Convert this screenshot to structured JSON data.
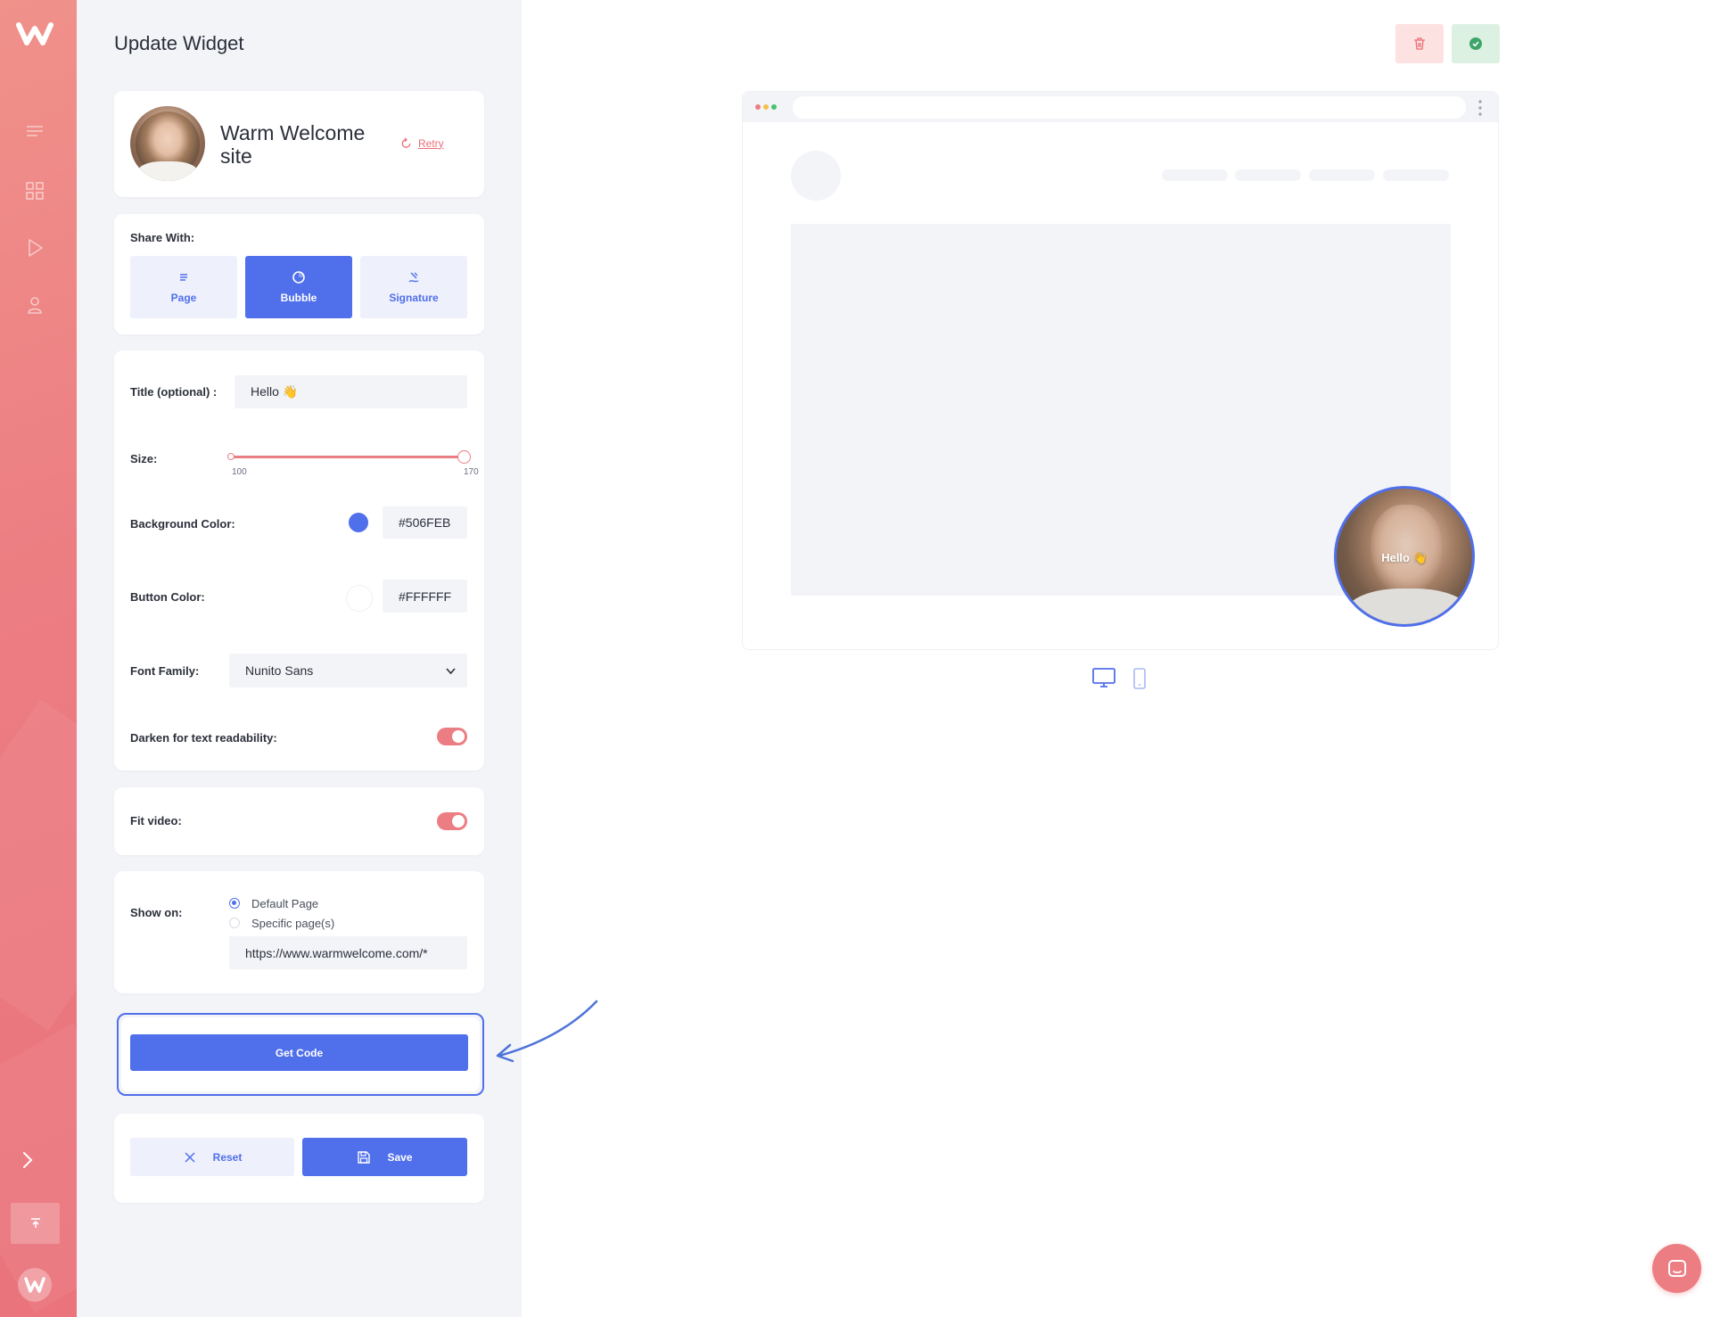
{
  "page": {
    "title": "Update Widget"
  },
  "video": {
    "name": "Warm Welcome site",
    "retry_label": "Retry"
  },
  "share": {
    "label": "Share With:",
    "options": [
      {
        "label": "Page",
        "icon": "page-lines-icon",
        "active": false
      },
      {
        "label": "Bubble",
        "icon": "bubble-circle-icon",
        "active": true
      },
      {
        "label": "Signature",
        "icon": "signature-pen-icon",
        "active": false
      }
    ]
  },
  "form": {
    "title_label": "Title (optional) :",
    "title_value": "Hello 👋",
    "size_label": "Size:",
    "size_min": "100",
    "size_max": "170",
    "size_value": 170,
    "bg_color_label": "Background Color:",
    "bg_color_value": "#506FEB",
    "button_color_label": "Button Color:",
    "button_color_value": "#FFFFFF",
    "font_label": "Font Family:",
    "font_value": "Nunito Sans",
    "darken_label": "Darken for text readability:",
    "darken_on": true
  },
  "fit": {
    "label": "Fit video:",
    "on": true
  },
  "show_on": {
    "label": "Show on:",
    "options": [
      {
        "label": "Default Page",
        "checked": true
      },
      {
        "label": "Specific page(s)",
        "checked": false
      }
    ],
    "url_value": "https://www.warmwelcome.com/*"
  },
  "actions": {
    "get_code": "Get Code",
    "reset": "Reset",
    "save": "Save"
  },
  "preview": {
    "bubble_title": "Hello 👋"
  },
  "colors": {
    "accent": "#506FEB",
    "brand_coral": "#EC7D82",
    "delete_bg": "#FDE2E2",
    "confirm_bg": "#DDF1E3"
  },
  "icons": {
    "sidebar": [
      "logo-icon",
      "menu-lines-icon",
      "grid-icon",
      "play-icon",
      "user-icon",
      "chevron-right-icon",
      "upload-icon",
      "avatar-logo-icon"
    ],
    "top": [
      "trash-icon",
      "check-circle-icon"
    ],
    "devices": [
      "desktop-icon",
      "mobile-icon"
    ],
    "chat": "chat-icon"
  }
}
